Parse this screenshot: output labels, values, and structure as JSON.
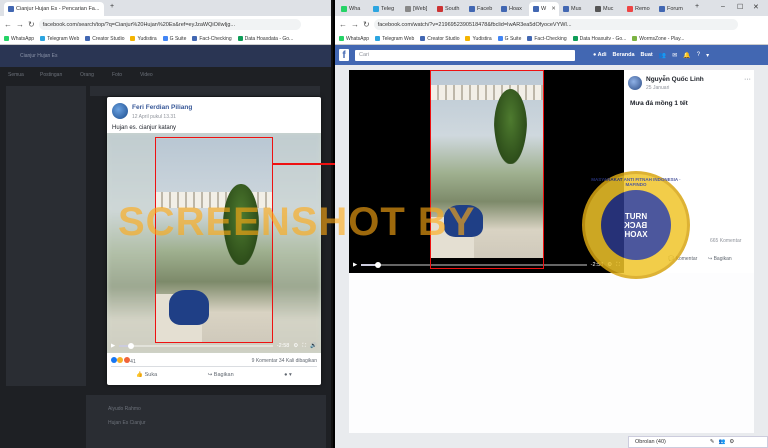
{
  "left_window": {
    "tab_title": "Cianjur Hujan Es - Pencarian Fa...",
    "url": "facebook.com/search/top/?q=Cianjur%20Hujan%20Es&ref=eyJzaWQiOiIwIjg...",
    "bookmarks": [
      "WhatsApp",
      "Telegram Web",
      "Creator Studio",
      "Yudistira",
      "G Suite",
      "Fact-Checking",
      "Data Hoaxdata - Go..."
    ],
    "bg_search": "Cianjur Hujan Es",
    "bg_menu": [
      "Semua",
      "Postingan",
      "Orang",
      "Foto",
      "Video"
    ],
    "bg_more_title": "Aiyudo Rahmo",
    "bg_sub": "Hujan Es Cianjur",
    "post": {
      "author": "Feri Ferdian Piliang",
      "meta": "12 April pukul 13.31",
      "caption": "Hujan es. cianjur katany",
      "time_left": "-2:58",
      "reactions_count": "41",
      "comments_shares": "9 Komentar  34 Kali dibagikan",
      "like_label": "Suka",
      "share_label": "Bagikan"
    }
  },
  "right_window": {
    "tabs": [
      "Wha",
      "Teleg",
      "[Web]",
      "South",
      "Faceb",
      "Hoax",
      "W",
      "Mus",
      "Muc",
      "Remo",
      "Forum"
    ],
    "url": "facebook.com/watch/?v=2196952390518478&fbclid=IwAR3ea5dOfyoceVYWI...",
    "bookmarks": [
      "WhatsApp",
      "Telegram Web",
      "Creator Studio",
      "Yudistira",
      "G Suite",
      "Fact-Checking",
      "Data Hoaxuitv - Go...",
      "WormsZone - Play..."
    ],
    "search_placeholder": "Cari",
    "nav": [
      "Adi",
      "Beranda",
      "Buat"
    ],
    "video": {
      "time_left": "-2:58"
    },
    "side": {
      "author": "Nguyễn Quốc Linh",
      "meta": "25 Januari",
      "caption": "Mưa đá mồng 1 tết",
      "comments": "665 Komentar",
      "comment_label": "Komentar",
      "share_label": "Bagikan"
    },
    "chat": "Obrolan (40)"
  },
  "watermark": "SCREENSHOT BY",
  "badge": {
    "outer_text": "MASYARAKAT ANTI FITNAH INDONESIA · MAFINDO",
    "inner": [
      "TURN",
      "BACK",
      "HOAX"
    ]
  },
  "colors": {
    "facebook_blue": "#4267b2",
    "highlight_red": "#ee1111",
    "watermark": "#ffaa14"
  }
}
